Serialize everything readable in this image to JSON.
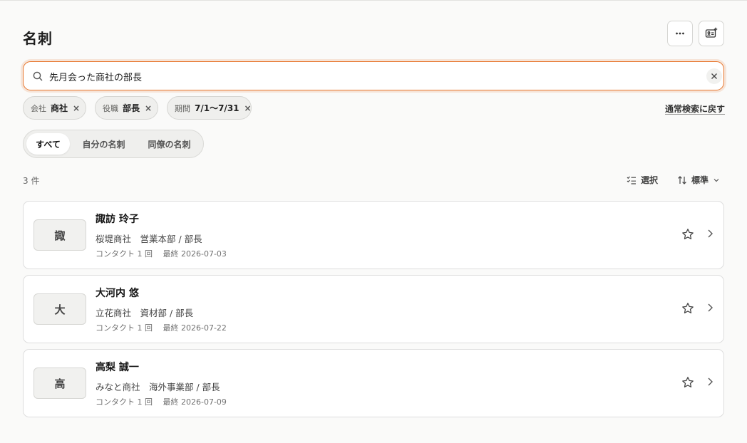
{
  "page": {
    "title": "名刺"
  },
  "header": {
    "more_icon": "more-horizontal-icon",
    "add_icon": "add-card-icon"
  },
  "search": {
    "value": "先月会った商社の部長",
    "icon": "search-icon",
    "clear_icon": "close-icon"
  },
  "filters": [
    {
      "key": "会社",
      "value": "商社",
      "remove": "×"
    },
    {
      "key": "役職",
      "value": "部長",
      "remove": "×"
    },
    {
      "key": "期間",
      "value": "7/1〜7/31",
      "remove": "×"
    }
  ],
  "reset_link": "通常検索に戻す",
  "segments": [
    {
      "label": "すべて",
      "active": true
    },
    {
      "label": "自分の名刺",
      "active": false
    },
    {
      "label": "同僚の名刺",
      "active": false
    }
  ],
  "results": {
    "count_text": "3 件"
  },
  "toolbar": {
    "select_label": "選択",
    "sort_label": "標準"
  },
  "cards": [
    {
      "initial": "諏",
      "name": "諏訪 玲子",
      "org": "桜堤商社　営業本部 / 部長",
      "meta": "コンタクト 1 回　 最終 2026-07-03"
    },
    {
      "initial": "大",
      "name": "大河内 悠",
      "org": "立花商社　資材部 / 部長",
      "meta": "コンタクト 1 回　 最終 2026-07-22"
    },
    {
      "initial": "高",
      "name": "高梨 誠一",
      "org": "みなと商社　海外事業部 / 部長",
      "meta": "コンタクト 1 回　 最終 2026-07-09"
    }
  ],
  "colors": {
    "accent": "#e8772e",
    "background": "#fafaf9"
  }
}
